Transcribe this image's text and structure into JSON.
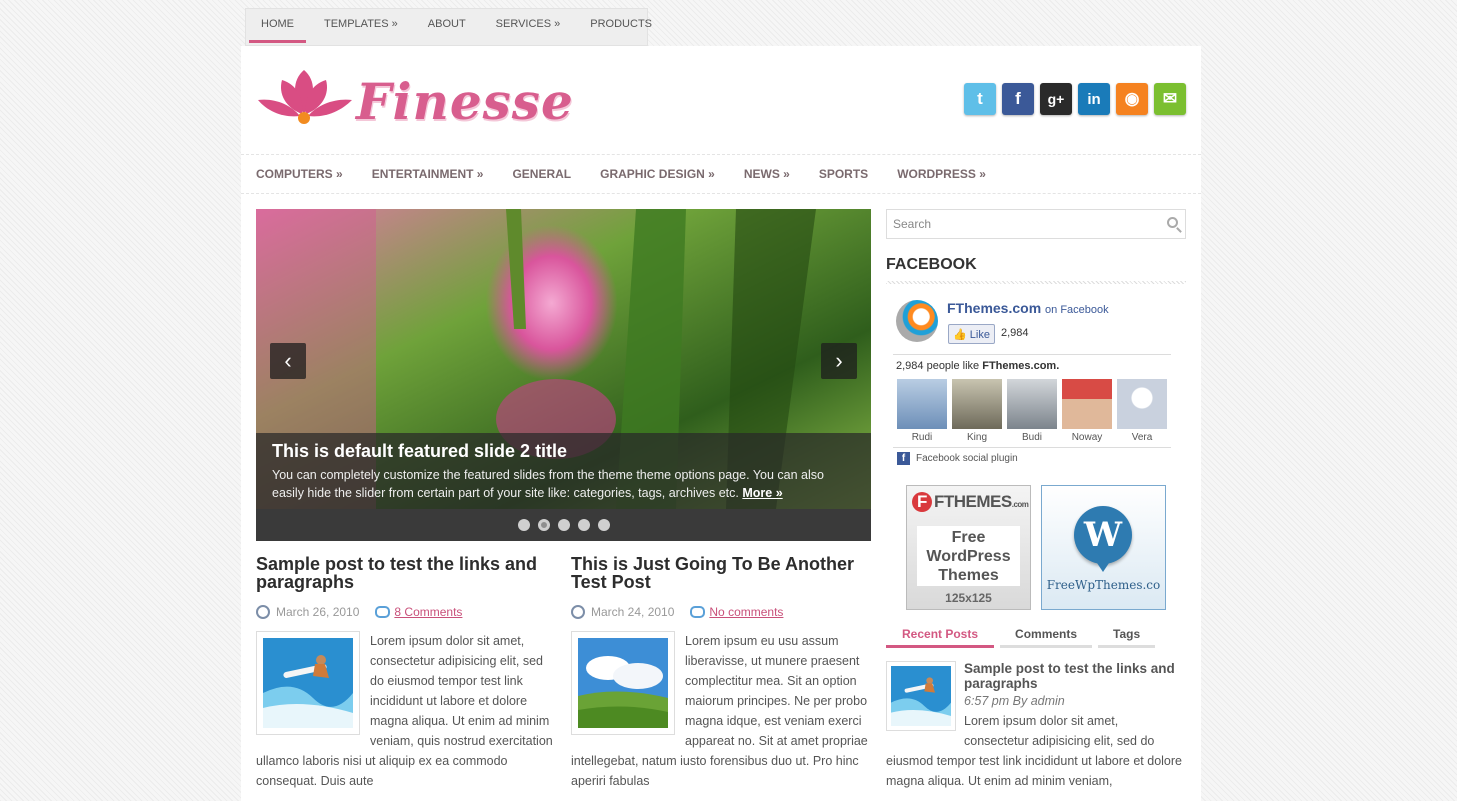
{
  "top_menu": [
    {
      "label": "HOME"
    },
    {
      "label": "TEMPLATES »"
    },
    {
      "label": "ABOUT"
    },
    {
      "label": "SERVICES »"
    },
    {
      "label": "PRODUCTS"
    }
  ],
  "logo": {
    "text": "Finesse"
  },
  "social": [
    {
      "icon": "twitter-icon",
      "glyph": "t",
      "color": "#5fbfe8"
    },
    {
      "icon": "facebook-icon",
      "glyph": "f",
      "color": "#3b5998"
    },
    {
      "icon": "google-plus-icon",
      "glyph": "g+",
      "color": "#2a2a2a"
    },
    {
      "icon": "linkedin-icon",
      "glyph": "in",
      "color": "#1a7bb9"
    },
    {
      "icon": "rss-icon",
      "glyph": "◉",
      "color": "#f58220"
    },
    {
      "icon": "email-icon",
      "glyph": "✉",
      "color": "#7bbf30"
    }
  ],
  "categories": [
    {
      "label": "COMPUTERS »"
    },
    {
      "label": "ENTERTAINMENT »"
    },
    {
      "label": "GENERAL"
    },
    {
      "label": "GRAPHIC DESIGN »"
    },
    {
      "label": "NEWS »"
    },
    {
      "label": "SPORTS"
    },
    {
      "label": "WORDPRESS »"
    }
  ],
  "slider": {
    "prev_glyph": "‹",
    "next_glyph": "›",
    "title": "This is default featured slide 2 title",
    "text": "You can completely customize the featured slides from the theme theme options page. You can also easily hide the slider from certain part of your site like: categories, tags, archives etc.",
    "more_label": "More »"
  },
  "posts": [
    {
      "title": "Sample post to test the links and paragraphs",
      "date": "March 26, 2010",
      "comments": "8 Comments",
      "excerpt": "Lorem ipsum dolor sit amet, consectetur adipisicing elit, sed do eiusmod tempor test link incididunt ut labore et dolore magna aliqua. Ut enim ad minim veniam, quis nostrud exercitation ullamco laboris nisi ut aliquip ex ea commodo consequat. Duis aute"
    },
    {
      "title": "This is Just Going To Be Another Test Post",
      "date": "March 24, 2010",
      "comments": "No comments",
      "excerpt": "Lorem ipsum eu usu assum liberavisse, ut munere praesent complectitur mea. Sit an option maiorum principes. Ne per probo magna idque, est veniam exerci appareat no. Sit at amet propriae intellegebat, natum iusto forensibus duo ut. Pro hinc aperiri fabulas"
    }
  ],
  "sidebar": {
    "search_placeholder": "Search",
    "facebook_title": "FACEBOOK",
    "fb": {
      "page_name": "FThemes.com",
      "on_label": "on Facebook",
      "like_label": "Like",
      "like_count": "2,984",
      "people_prefix": "2,984 people like ",
      "people_page": "FThemes.com.",
      "faces": [
        {
          "name": "Rudi",
          "color": "#7a9ec7"
        },
        {
          "name": "King",
          "color": "#8e8e7a"
        },
        {
          "name": "Budi",
          "color": "#9aa0a6"
        },
        {
          "name": "Noway",
          "color": "#c8504a"
        },
        {
          "name": "Vera",
          "color": "#c9d1de"
        }
      ],
      "plugin_label": "Facebook social plugin"
    },
    "ad1": {
      "brand": "FTHEMES",
      "brand_suffix": ".com",
      "line1": "Free",
      "line2": "WordPress",
      "line3": "Themes",
      "size": "125x125"
    },
    "ad2": {
      "label": "FreeWpThemes.co"
    },
    "tabs": [
      {
        "label": "Recent Posts"
      },
      {
        "label": "Comments"
      },
      {
        "label": "Tags"
      }
    ],
    "recent": {
      "title": "Sample post to test the links and paragraphs",
      "meta": "6:57 pm By admin",
      "excerpt": "Lorem ipsum dolor sit amet, consectetur adipisicing elit, sed do eiusmod tempor test link incididunt ut labore et dolore magna aliqua. Ut enim ad minim veniam,"
    }
  },
  "colors": {
    "accent": "#d35882",
    "link": "#c9507a"
  }
}
